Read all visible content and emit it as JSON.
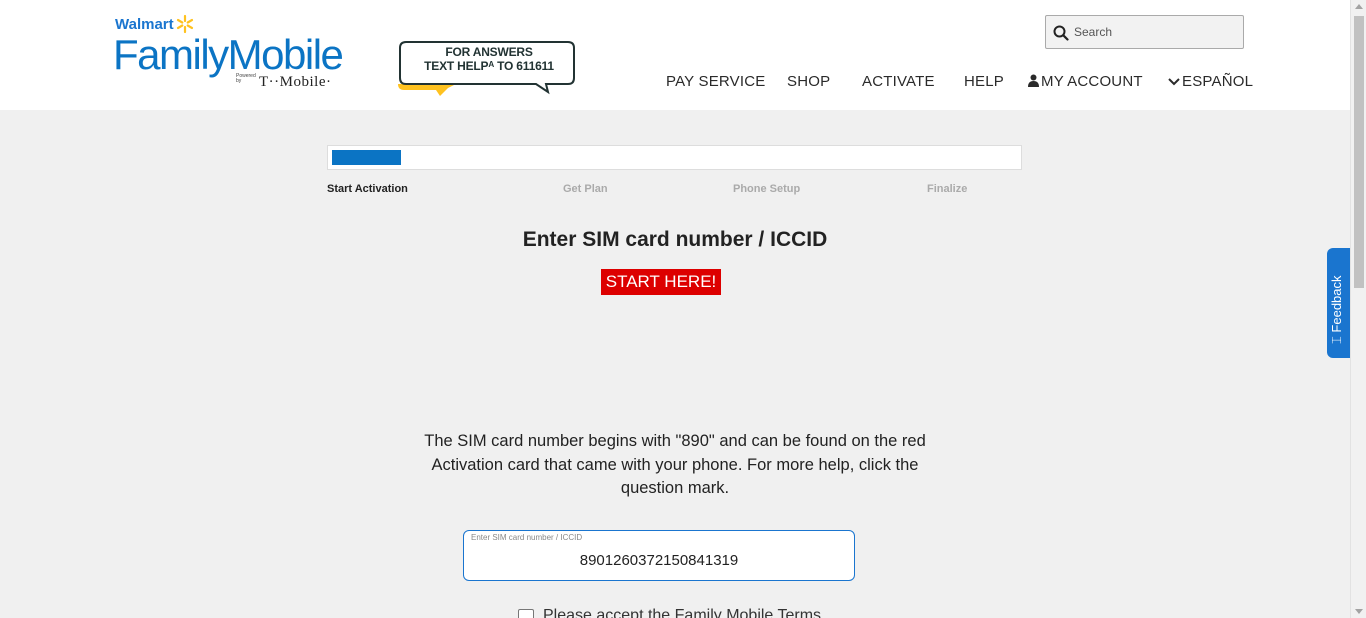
{
  "header": {
    "logo": {
      "walmart": "Walmart",
      "family_mobile": "FamilyMobile",
      "powered_by": "Powered by",
      "tmobile": "T··Mobile·"
    },
    "answers_banner": {
      "line1": "FOR ANSWERS",
      "line2": "TEXT HELPᴬ TO 611611"
    },
    "search": {
      "placeholder": "Search"
    },
    "nav": {
      "pay_service": "PAY SERVICE",
      "shop": "SHOP",
      "activate": "ACTIVATE",
      "help": "HELP",
      "my_account": "MY ACCOUNT",
      "espanol": "ESPAÑOL"
    }
  },
  "progress": {
    "value": 0.1,
    "steps": [
      "Start Activation",
      "Get Plan",
      "Phone Setup",
      "Finalize"
    ]
  },
  "main": {
    "title": "Enter SIM card number / ICCID",
    "start_button": "START HERE!",
    "help_text": "The SIM card number begins with \"890\" and can be found on the red Activation card that came with your phone. For more help, click the question mark.",
    "sim_field": {
      "label": "Enter SIM card number / ICCID",
      "value": "8901260372150841319"
    },
    "terms": "Please accept the Family Mobile Terms"
  },
  "feedback": {
    "label": "Feedback"
  },
  "colors": {
    "brand_blue": "#0b74c4",
    "start_red": "#dd0000",
    "spark_yellow": "#ffc220"
  }
}
